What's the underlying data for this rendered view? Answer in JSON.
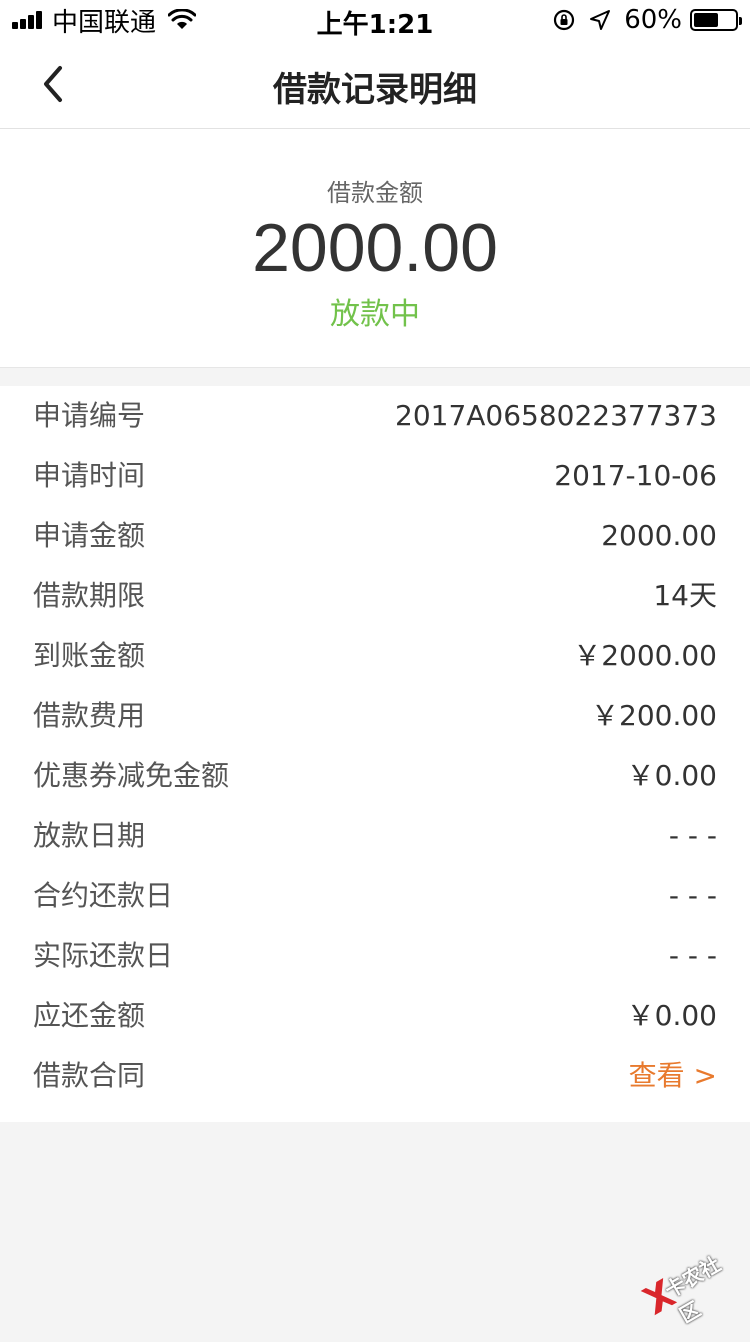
{
  "status_bar": {
    "carrier": "中国联通",
    "time": "上午1:21",
    "battery_percent": "60%",
    "battery_level": 0.6,
    "icons": [
      "signal-icon",
      "wifi-icon",
      "orientation-lock-icon",
      "location-icon",
      "battery-icon"
    ]
  },
  "nav": {
    "title": "借款记录明细",
    "back_icon": "chevron-left-icon"
  },
  "summary": {
    "label": "借款金额",
    "amount": "2000.00",
    "status": "放款中",
    "status_color": "#72c24b"
  },
  "details": {
    "rows": [
      {
        "label": "申请编号",
        "value": "2017A0658022377373"
      },
      {
        "label": "申请时间",
        "value": "2017-10-06"
      },
      {
        "label": "申请金额",
        "value": "2000.00"
      },
      {
        "label": "借款期限",
        "value": "14天"
      },
      {
        "label": "到账金额",
        "value": "￥2000.00"
      },
      {
        "label": "借款费用",
        "value": "￥200.00"
      },
      {
        "label": "优惠券减免金额",
        "value": "￥0.00"
      },
      {
        "label": "放款日期",
        "value": "- - -"
      },
      {
        "label": "合约还款日",
        "value": "- - -"
      },
      {
        "label": "实际还款日",
        "value": "- - -"
      },
      {
        "label": "应还金额",
        "value": "￥0.00"
      }
    ],
    "contract": {
      "label": "借款合同",
      "link": "查看 >",
      "link_color": "#e87a2e"
    }
  },
  "watermark": {
    "text": "卡农社区"
  }
}
